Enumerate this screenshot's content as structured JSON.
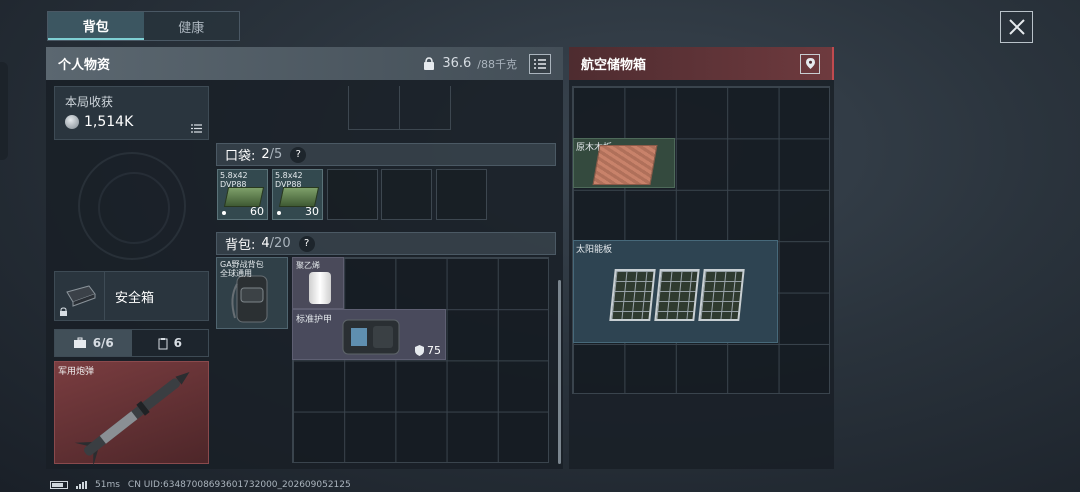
{
  "top_tabs": [
    "背包",
    "健康"
  ],
  "personal": {
    "title": "个人物资",
    "weight_current": "36.6",
    "weight_max": "/88千克"
  },
  "harvest": {
    "label": "本局收获",
    "value": "1,514K"
  },
  "safe_box": {
    "label": "安全箱"
  },
  "slot_tabs": [
    {
      "label": "6/6"
    },
    {
      "label": "6"
    }
  ],
  "left_item": {
    "label": "军用炮弹"
  },
  "pocket": {
    "label": "口袋:",
    "used": "2",
    "cap": "/5",
    "items": [
      {
        "name_line1": "5.8x42",
        "name_line2": "DVP88",
        "qty": "60"
      },
      {
        "name_line1": "5.8x42",
        "name_line2": "DVP88",
        "qty": "30"
      }
    ]
  },
  "backpack": {
    "label": "背包:",
    "used": "4",
    "cap": "/20",
    "bag_name_line1": "GA野战背包",
    "bag_name_line2": "全球通用",
    "wire_label": "聚乙烯",
    "armor_label": "标准护甲",
    "armor_durability": "75"
  },
  "airdrop": {
    "title": "航空储物箱",
    "items": [
      {
        "label": "原木木板"
      },
      {
        "label": "太阳能板"
      }
    ]
  },
  "status_bar": {
    "ping": "51ms",
    "uid": "CN UID:634870086936017320​00_202609052125"
  },
  "colors": {
    "accent_teal": "#7fd0d4",
    "airdrop_red": "#c04a4f"
  },
  "icons": [
    "close-icon",
    "weight-icon",
    "list-icon",
    "coin-icon",
    "lock-icon",
    "briefcase-icon",
    "clipboard-icon",
    "shield-icon",
    "location-icon",
    "battery-icon",
    "signal-icon"
  ]
}
